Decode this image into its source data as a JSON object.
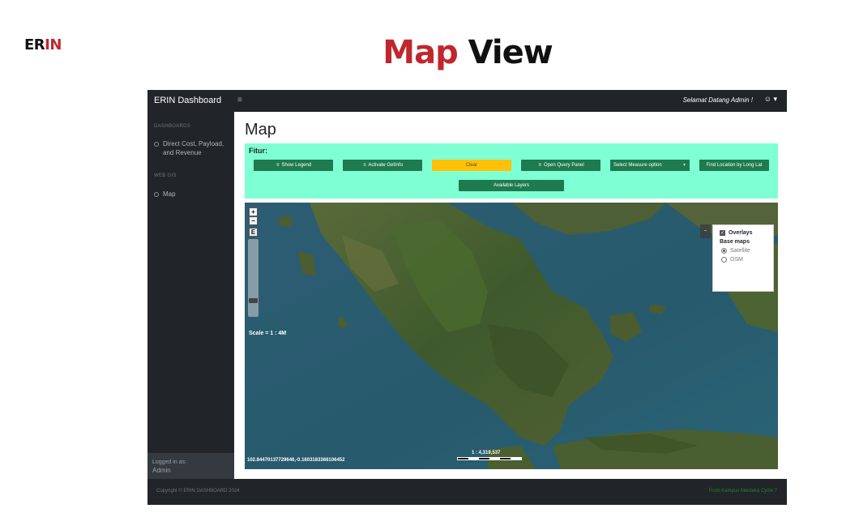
{
  "slide": {
    "brand_part1": "ER",
    "brand_part2": "IN",
    "title_part1": "Map",
    "title_part2": "View"
  },
  "topbar": {
    "app_name": "ERIN Dashboard",
    "welcome": "Selamat Datang Admin !",
    "menu_icon": "hamburger-icon",
    "user_icon": "user-icon"
  },
  "sidebar": {
    "heading_dashboards": "DASHBOARDS",
    "item_cost_line1": "Direct Cost, Payload,",
    "item_cost_line2": "and Revenue",
    "heading_webgis": "WEB GIS",
    "item_map": "Map",
    "logged_in_label": "Logged in as:",
    "logged_in_user": "Admin"
  },
  "page": {
    "heading": "Map",
    "fitur_label": "Fitur:"
  },
  "toolbar": {
    "show_legend": "Show Legend",
    "activate_getinfo": "Activate GetInfo",
    "clear": "Clear",
    "open_query_panel": "Open Query Panel",
    "measure_select": "Select Measure option",
    "find_location": "Find Location by Long Lat",
    "available_layers": "Available Layers"
  },
  "map": {
    "zoom_in": "+",
    "zoom_out": "−",
    "extent": "E",
    "scale_text": "Scale = 1 : 4M",
    "coordinates": "102.84470137729646,-0.1603183366106452",
    "scalebar_ratio": "1 : 4,319,537",
    "layer_switcher": {
      "overlays": "Overlays",
      "base_maps": "Base maps",
      "satellite": "Satellite",
      "osm": "OSM"
    }
  },
  "footer": {
    "copyright": "Copyright © ERIN DASHBOARD 2024",
    "credit": "From Kampus Merdeka Cycle 7"
  },
  "colors": {
    "brand_red": "#c0272d",
    "dark_bg": "#212529",
    "fitur_bg": "#7fffd4",
    "button_green": "#1f7a4f",
    "button_yellow": "#ffc107"
  }
}
